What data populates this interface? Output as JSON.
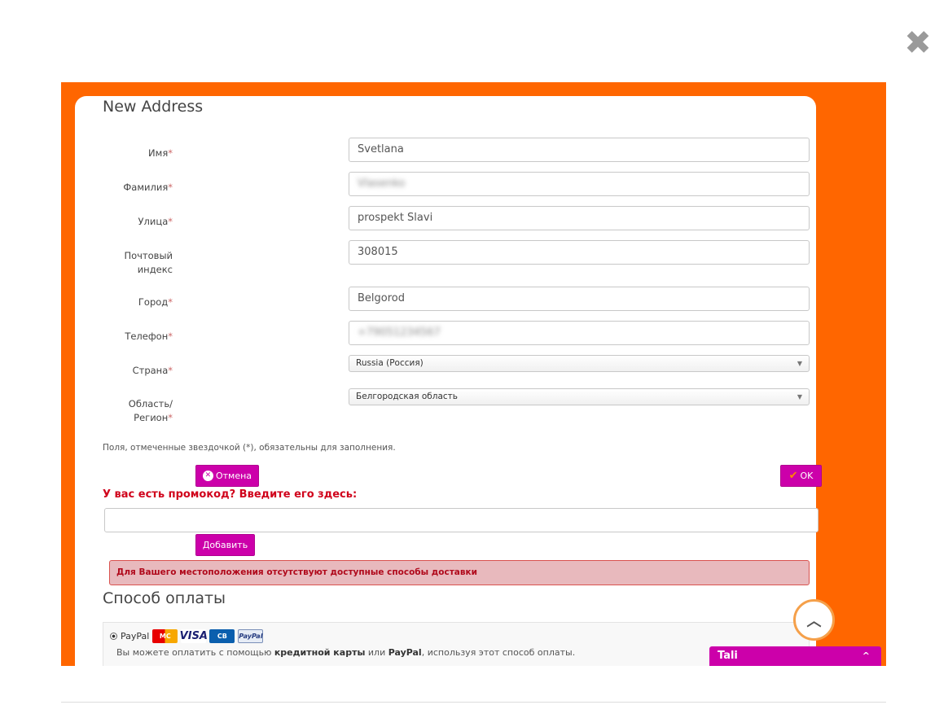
{
  "close_icon": "✖",
  "form": {
    "title": "New Address",
    "fields": [
      {
        "label": "Имя",
        "value": "Svetlana"
      },
      {
        "label": "Фамилия",
        "value": "Vlasenko"
      },
      {
        "label": "Улица",
        "value": "prospekt Slavi"
      },
      {
        "label_line1": "Почтовый",
        "label_line2": "индекс",
        "value": "308015"
      },
      {
        "label": "Город",
        "value": "Belgorod"
      },
      {
        "label": "Телефон",
        "value": "+79051234567"
      },
      {
        "label": "Страна",
        "value": "Russia (Россия)"
      },
      {
        "label_line1": "Область/",
        "label_line2": "Регион",
        "value": "Белгородская область"
      }
    ],
    "required_mark": "*",
    "required_note": "Поля, отмеченные звездочкой (*), обязательны для заполнения.",
    "cancel_label": "Отмена",
    "ok_label": "OK"
  },
  "promo": {
    "title": "У вас есть промокод? Введите его здесь:",
    "input_value": "",
    "add_label": "Добавить"
  },
  "alert": {
    "text": "Для Вашего местоположения отсутствуют доступные способы доставки"
  },
  "payment": {
    "title": "Способ оплаты",
    "method_label": "PayPal",
    "cards": [
      "MasterCard",
      "VISA",
      "CB",
      "PayPal"
    ],
    "desc_prefix": "Вы можете оплатить с помощью ",
    "desc_bold1": "кредитной карты",
    "desc_mid": " или ",
    "desc_bold2": "PayPal",
    "desc_suffix": ", используя этот способ оплаты."
  },
  "chat": {
    "label": "Tali",
    "chevron": "^"
  },
  "colors": {
    "frame": "#ff6600",
    "button": "#cc00aa",
    "alert_bg": "#e8b9bd",
    "promo_title": "#d0021b"
  }
}
